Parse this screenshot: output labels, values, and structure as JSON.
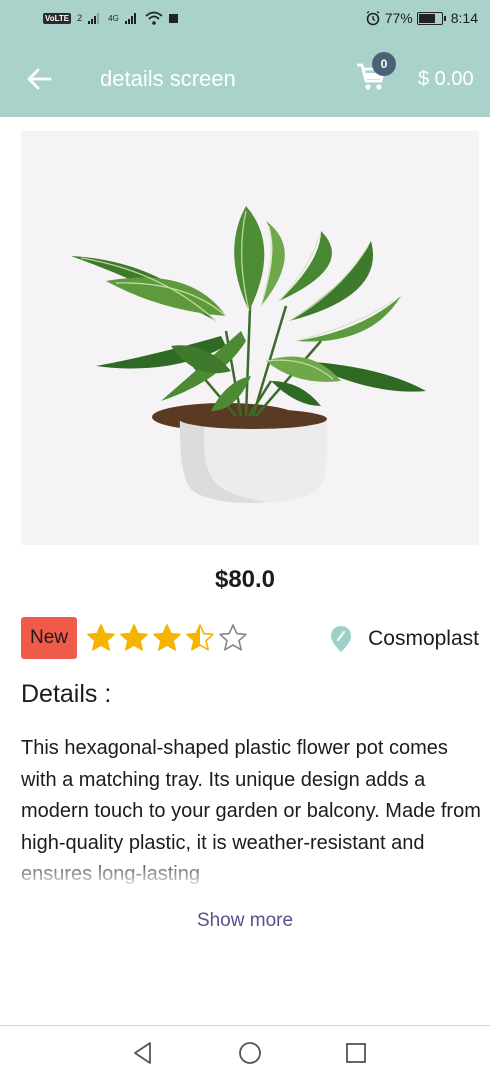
{
  "status_bar": {
    "volte": "VoLTE",
    "sim_slot": "2",
    "network": "4G",
    "battery": "77%",
    "time": "8:14"
  },
  "appbar": {
    "title": "details screen",
    "cart_count": "0",
    "cart_total": "$ 0.00"
  },
  "product": {
    "image": "plant-in-white-pot",
    "price": "$80.0",
    "badge": "New",
    "rating": 3.5,
    "rating_max": 5,
    "brand": "Cosmoplast",
    "details_heading": "Details :",
    "description": "This hexagonal-shaped plastic flower pot comes with a matching tray. Its unique design adds a modern touch to your garden or balcony. Made from high-quality plastic, it is weather-resistant and ensures long-lasting",
    "show_more": "Show more"
  },
  "colors": {
    "appbar": "#a9d2cb",
    "badge": "#f05a4a",
    "star": "#f5b400",
    "pin": "#9fcfc9",
    "link": "#5b4e8c"
  },
  "icons": {
    "back": "arrow-left-icon",
    "cart": "shopping-cart-icon",
    "pin": "location-pin-icon",
    "nav_back": "triangle-back-icon",
    "nav_home": "circle-home-icon",
    "nav_recent": "square-recents-icon"
  }
}
